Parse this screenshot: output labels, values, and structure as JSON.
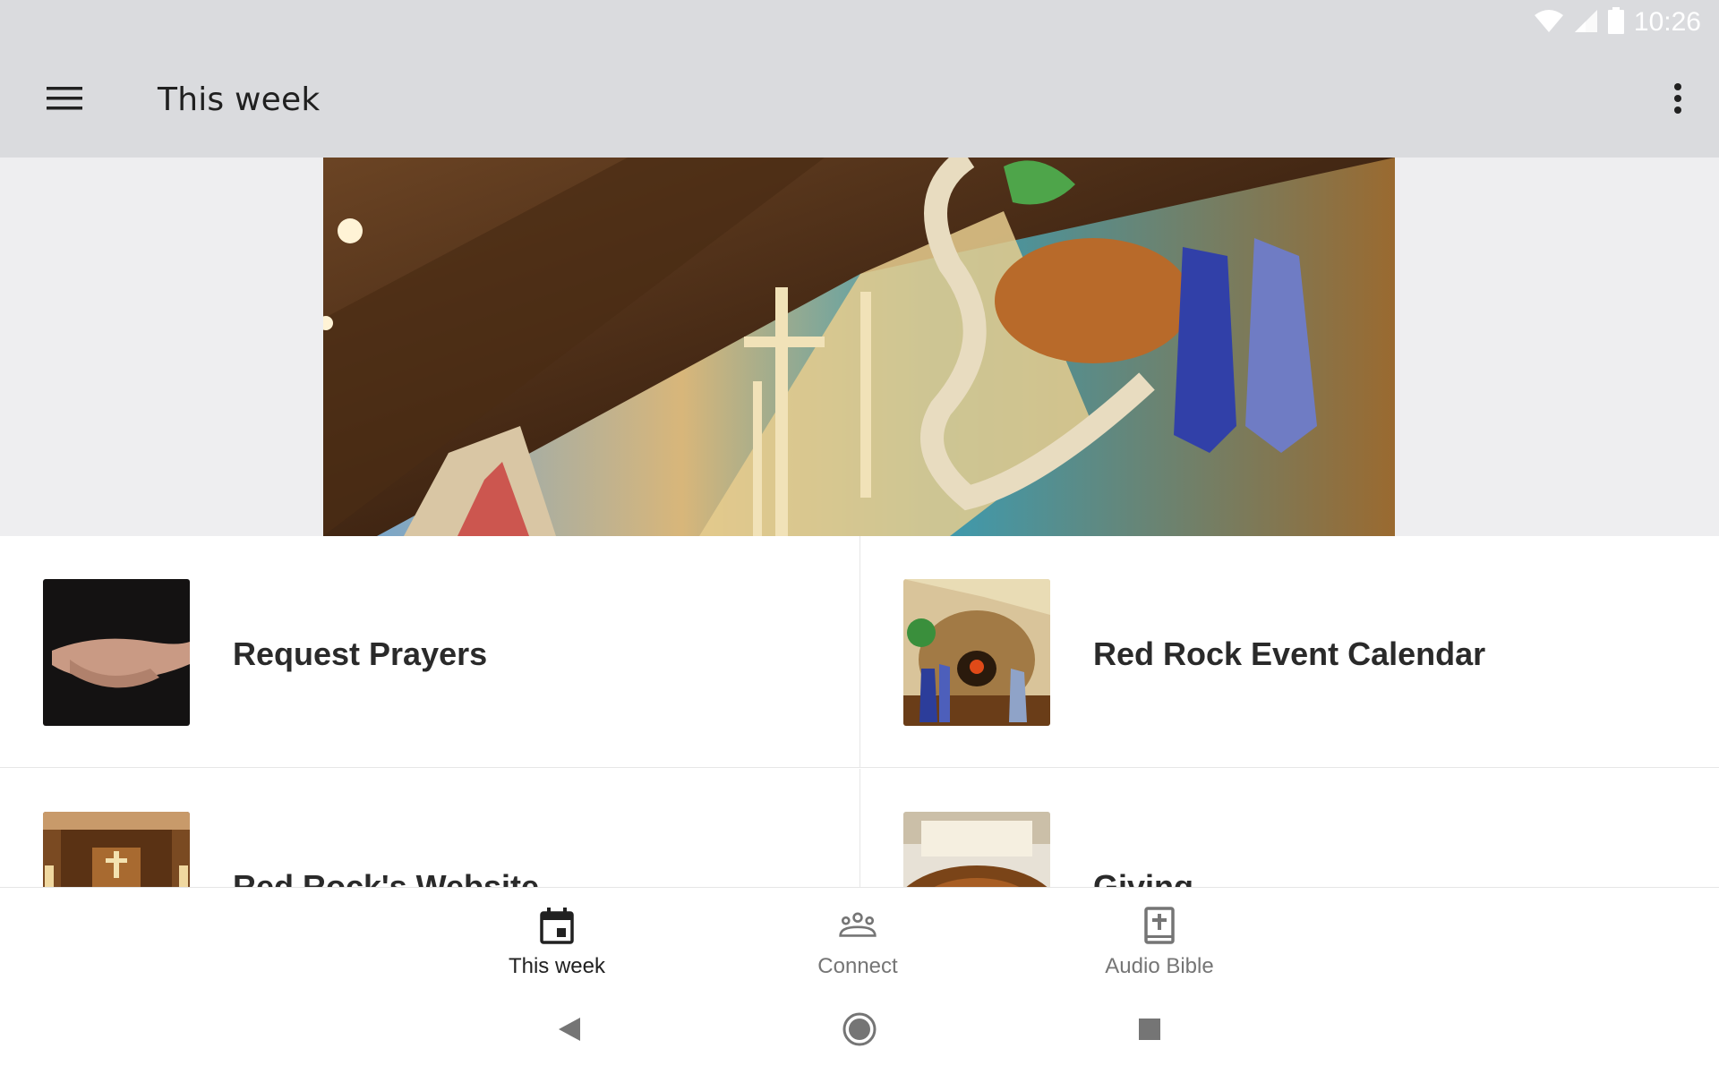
{
  "status_bar": {
    "time": "10:26",
    "icons": [
      "wifi-icon",
      "cell-signal-icon",
      "battery-icon"
    ]
  },
  "app_bar": {
    "title": "This week",
    "menu_icon": "hamburger-menu-icon",
    "overflow_icon": "more-vert-icon"
  },
  "hero": {
    "image": "stained-glass-window-banner"
  },
  "tiles": [
    {
      "label": "Request Prayers",
      "thumbnail": "praying-hands-image"
    },
    {
      "label": "Red Rock Event Calendar",
      "thumbnail": "stained-glass-tomb-image"
    },
    {
      "label": "Red Rock's Website",
      "thumbnail": "church-altar-image"
    },
    {
      "label": "Giving",
      "thumbnail": "offering-plate-image"
    }
  ],
  "bottom_nav": {
    "items": [
      {
        "label": "This week",
        "icon": "calendar-icon",
        "active": true
      },
      {
        "label": "Connect",
        "icon": "people-group-icon",
        "active": false
      },
      {
        "label": "Audio Bible",
        "icon": "bible-icon",
        "active": false
      }
    ]
  },
  "system_nav": [
    "back-icon",
    "home-icon",
    "recents-icon"
  ],
  "colors": {
    "app_bar_bg": "#dadbde",
    "hero_band_bg": "#eeeef0",
    "nav_active": "#212121",
    "nav_inactive": "#757575"
  }
}
